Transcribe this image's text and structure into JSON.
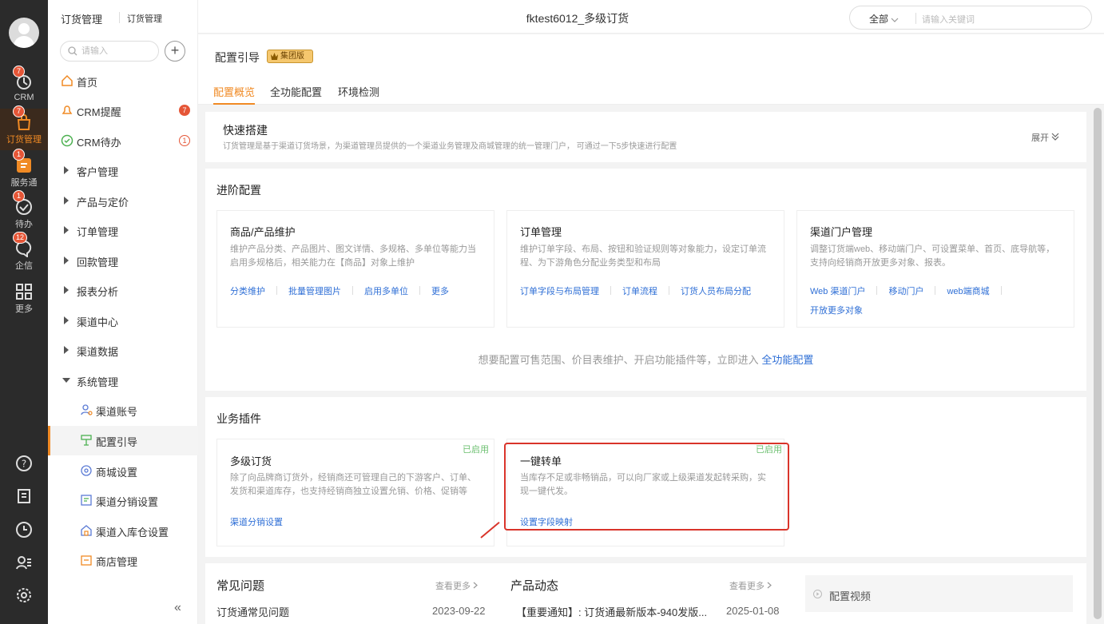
{
  "rail": {
    "items": [
      {
        "label": "CRM",
        "badge": "7",
        "icon": "crm-icon"
      },
      {
        "label": "订货管理",
        "badge": "7",
        "icon": "bag-icon"
      },
      {
        "label": "服务通",
        "badge": "1",
        "icon": "service-icon"
      },
      {
        "label": "待办",
        "badge": "1",
        "icon": "todo-check-icon"
      },
      {
        "label": "企信",
        "badge": "12",
        "icon": "chat-icon"
      },
      {
        "label": "更多",
        "badge": "",
        "icon": "grid-icon"
      }
    ],
    "bottom_icons": [
      "help-icon",
      "notebook-icon",
      "clock-icon",
      "contacts-icon",
      "settings-gear-icon"
    ],
    "active_color": "#f08a24"
  },
  "breadcrumb": {
    "first": "订货管理",
    "second": "订货管理"
  },
  "window_title": "fktest6012_多级订货",
  "global_search": {
    "scope": "全部",
    "placeholder": "请输入关键词"
  },
  "sidebar": {
    "search_placeholder": "请输入",
    "add_label": "+",
    "items": [
      {
        "label": "首页",
        "type": "top",
        "icon": "home-icon"
      },
      {
        "label": "CRM提醒",
        "type": "top",
        "icon": "bell-icon",
        "badge": "7"
      },
      {
        "label": "CRM待办",
        "type": "top",
        "icon": "check-circle-icon",
        "badge": "1"
      },
      {
        "label": "客户管理",
        "type": "group"
      },
      {
        "label": "产品与定价",
        "type": "group"
      },
      {
        "label": "订单管理",
        "type": "group"
      },
      {
        "label": "回款管理",
        "type": "group"
      },
      {
        "label": "报表分析",
        "type": "group"
      },
      {
        "label": "渠道中心",
        "type": "group"
      },
      {
        "label": "渠道数据",
        "type": "group"
      },
      {
        "label": "系统管理",
        "type": "group-open"
      },
      {
        "label": "渠道账号",
        "type": "sub",
        "icon": "account-icon"
      },
      {
        "label": "配置引导",
        "type": "sub",
        "icon": "guide-icon",
        "selected": true
      },
      {
        "label": "商城设置",
        "type": "sub",
        "icon": "mall-settings-icon"
      },
      {
        "label": "渠道分销设置",
        "type": "sub",
        "icon": "distribution-icon"
      },
      {
        "label": "渠道入库仓设置",
        "type": "sub",
        "icon": "warehouse-icon"
      },
      {
        "label": "商店管理",
        "type": "sub",
        "icon": "store-icon"
      }
    ],
    "collapse_glyph": "«"
  },
  "page": {
    "title": "配置引导",
    "edition_badge": "集团版",
    "tabs": [
      "配置概览",
      "全功能配置",
      "环境检测"
    ],
    "active_tab": 0
  },
  "quick_build": {
    "title": "快速搭建",
    "desc": "订货管理是基于渠道订货场景，为渠道管理员提供的一个渠道业务管理及商城管理的统一管理门户， 可通过一下5步快速进行配置",
    "expand_label": "展开"
  },
  "advanced": {
    "title": "进阶配置",
    "cards": [
      {
        "title": "商品/产品维护",
        "desc": "维护产品分类、产品图片、图文详情、多规格、多单位等能力当启用多规格后，相关能力在【商品】对象上维护",
        "links": [
          "分类维护",
          "批量管理图片",
          "启用多单位",
          "更多"
        ]
      },
      {
        "title": "订单管理",
        "desc": "维护订单字段、布局、按钮和验证规则等对象能力，设定订单流程、为下游角色分配业务类型和布局",
        "links": [
          "订单字段与布局管理",
          "订单流程",
          "订货人员布局分配"
        ]
      },
      {
        "title": "渠道门户管理",
        "desc": "调整订货端web、移动端门户、可设置菜单、首页、底导航等，支持向经销商开放更多对象、报表。",
        "links": [
          "Web 渠道门户",
          "移动门户",
          "web端商城",
          "开放更多对象"
        ]
      }
    ],
    "footer_text": "想要配置可售范围、价目表维护、开启功能插件等，立即进入",
    "footer_link": "全功能配置"
  },
  "plugins": {
    "title": "业务插件",
    "cards": [
      {
        "title": "多级订货",
        "status": "已启用",
        "desc": "除了向品牌商订货外，经销商还可管理自己的下游客户、订单、发货和渠道库存，也支持经销商独立设置允销、价格、促销等",
        "link": "渠道分销设置"
      },
      {
        "title": "一键转单",
        "status": "已启用",
        "desc": "当库存不足或非畅销品，可以向厂家或上级渠道发起转采购，实现一键代发。",
        "link": "设置字段映射"
      }
    ]
  },
  "faq": {
    "title": "常见问题",
    "more": "查看更多",
    "item": "订货通常见问题",
    "date": "2023-09-22"
  },
  "news": {
    "title": "产品动态",
    "more": "查看更多",
    "item": "【重要通知】: 订货通最新版本-940发版...",
    "date": "2025-01-08"
  },
  "video": {
    "label": "配置视频"
  },
  "colors": {
    "accent": "#f08a24",
    "link": "#2f6fd6",
    "enabled": "#6cc070",
    "highlight": "#d9342a",
    "badge": "#e55637"
  }
}
